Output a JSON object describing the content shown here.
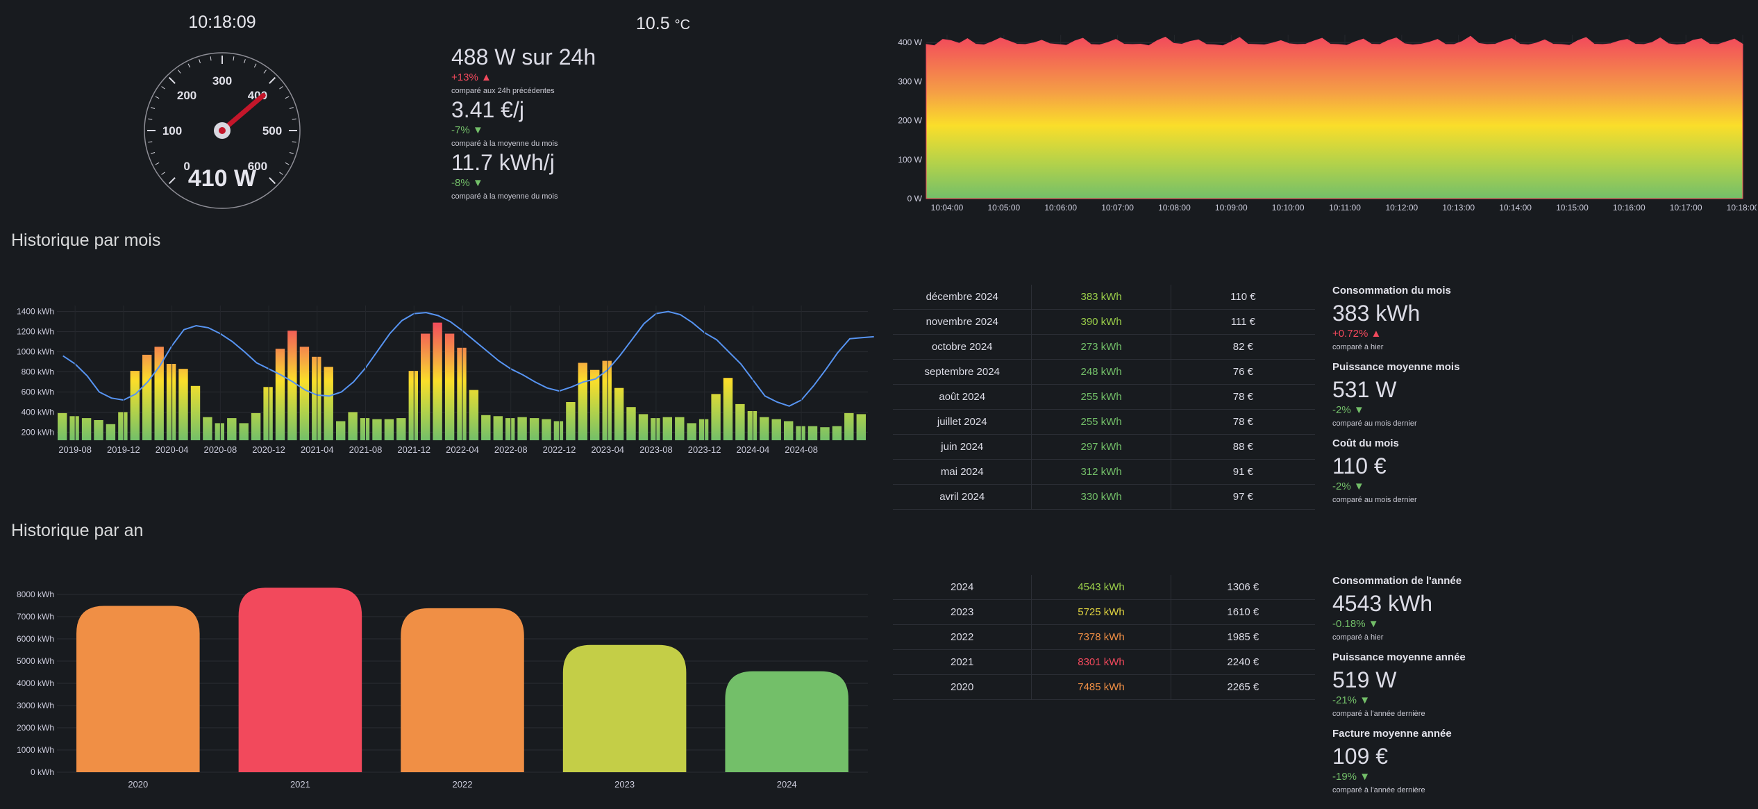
{
  "header": {
    "time": "10:18:09",
    "temperature": "10.5",
    "temperature_unit": "°C"
  },
  "gauge": {
    "value": 410,
    "display": "410 W",
    "min": 0,
    "max": 600,
    "labels": [
      "0",
      "100",
      "200",
      "300",
      "400",
      "500",
      "600"
    ]
  },
  "stats": [
    {
      "value": "488 W sur 24h",
      "delta": "+13%",
      "trend": "up",
      "caption": "comparé aux 24h précédentes"
    },
    {
      "value": "3.41 €/j",
      "delta": "-7%",
      "trend": "down",
      "caption": "comparé à la moyenne du mois"
    },
    {
      "value": "11.7 kWh/j",
      "delta": "-8%",
      "trend": "down",
      "caption": "comparé à la moyenne du mois"
    }
  ],
  "power_chart": {
    "type": "area",
    "y_ticks": [
      "0 W",
      "100 W",
      "200 W",
      "300 W",
      "400 W"
    ],
    "ylim": [
      0,
      420
    ],
    "x_ticks": [
      "10:04:00",
      "10:05:00",
      "10:06:00",
      "10:07:00",
      "10:08:00",
      "10:09:00",
      "10:10:00",
      "10:11:00",
      "10:12:00",
      "10:13:00",
      "10:14:00",
      "10:15:00",
      "10:16:00",
      "10:17:00",
      "10:18:00"
    ],
    "baseline": 400,
    "spike_samples": [
      395,
      392,
      408,
      405,
      398,
      410,
      396,
      394,
      402,
      412,
      404,
      396,
      395,
      399,
      406,
      397,
      395,
      393,
      404,
      411,
      395,
      394,
      400,
      408,
      396,
      395,
      396,
      392,
      405,
      414,
      398,
      396,
      403,
      407,
      395,
      394,
      392,
      402,
      413,
      396,
      395,
      394,
      399,
      405,
      397,
      395,
      396,
      404,
      411,
      396,
      395,
      393,
      402,
      409,
      396,
      395,
      405,
      412,
      397,
      394,
      396,
      401,
      408,
      395,
      395,
      403,
      416,
      398,
      395,
      396,
      404,
      410,
      396,
      394,
      399,
      407,
      396,
      395,
      393,
      405,
      413,
      396,
      395,
      397,
      404,
      408,
      396,
      395,
      400,
      412,
      397,
      394,
      396,
      406,
      410,
      396,
      395,
      402,
      409,
      396
    ]
  },
  "monthly_section": {
    "title": "Historique par mois"
  },
  "monthly_chart": {
    "type": "bar",
    "y_ticks": [
      "200 kWh",
      "400 kWh",
      "600 kWh",
      "800 kWh",
      "1000 kWh",
      "1200 kWh",
      "1400 kWh"
    ],
    "ylim": [
      120,
      1460
    ],
    "x_ticks": [
      "2019-08",
      "2019-12",
      "2020-04",
      "2020-08",
      "2020-12",
      "2021-04",
      "2021-08",
      "2021-12",
      "2022-04",
      "2022-08",
      "2022-12",
      "2023-04",
      "2023-08",
      "2023-12",
      "2024-04",
      "2024-08"
    ],
    "values": [
      390,
      360,
      340,
      320,
      280,
      400,
      810,
      970,
      1050,
      880,
      830,
      660,
      350,
      290,
      340,
      290,
      390,
      650,
      1030,
      1210,
      1050,
      950,
      850,
      310,
      400,
      340,
      330,
      330,
      340,
      810,
      1180,
      1290,
      1180,
      1040,
      620,
      370,
      360,
      340,
      350,
      340,
      330,
      310,
      500,
      890,
      820,
      910,
      640,
      450,
      380,
      340,
      350,
      350,
      290,
      330,
      580,
      740,
      480,
      410,
      350,
      330,
      310,
      260,
      260,
      250,
      260,
      390,
      380
    ],
    "trend_line": [
      960,
      880,
      760,
      600,
      540,
      520,
      580,
      700,
      860,
      1060,
      1220,
      1260,
      1240,
      1180,
      1100,
      1000,
      890,
      830,
      770,
      700,
      620,
      570,
      560,
      600,
      700,
      840,
      1010,
      1180,
      1310,
      1380,
      1390,
      1360,
      1300,
      1210,
      1110,
      1010,
      910,
      830,
      770,
      700,
      640,
      610,
      650,
      700,
      730,
      820,
      960,
      1120,
      1280,
      1380,
      1400,
      1370,
      1290,
      1190,
      1120,
      1000,
      880,
      720,
      560,
      500,
      460,
      520,
      660,
      820,
      990,
      1130,
      1140,
      1150
    ]
  },
  "monthly_table": [
    {
      "month": "décembre 2024",
      "kwh": "383 kWh",
      "cost": "110 €",
      "color": "#9ace4a"
    },
    {
      "month": "novembre 2024",
      "kwh": "390 kWh",
      "cost": "111 €",
      "color": "#9ace4a"
    },
    {
      "month": "octobre 2024",
      "kwh": "273 kWh",
      "cost": "82 €",
      "color": "#73bf69"
    },
    {
      "month": "septembre 2024",
      "kwh": "248 kWh",
      "cost": "76 €",
      "color": "#73bf69"
    },
    {
      "month": "août 2024",
      "kwh": "255 kWh",
      "cost": "78 €",
      "color": "#73bf69"
    },
    {
      "month": "juillet 2024",
      "kwh": "255 kWh",
      "cost": "78 €",
      "color": "#73bf69"
    },
    {
      "month": "juin 2024",
      "kwh": "297 kWh",
      "cost": "88 €",
      "color": "#73bf69"
    },
    {
      "month": "mai 2024",
      "kwh": "312 kWh",
      "cost": "91 €",
      "color": "#73bf69"
    },
    {
      "month": "avril 2024",
      "kwh": "330 kWh",
      "cost": "97 €",
      "color": "#73bf69"
    }
  ],
  "month_stats": [
    {
      "label": "Consommation du mois",
      "value": "383 kWh",
      "delta": "+0.72%",
      "trend": "up",
      "caption": "comparé à hier"
    },
    {
      "label": "Puissance moyenne mois",
      "value": "531 W",
      "delta": "-2%",
      "trend": "down",
      "caption": "comparé au mois dernier"
    },
    {
      "label": "Coût du mois",
      "value": "110 €",
      "delta": "-2%",
      "trend": "down",
      "caption": "comparé au mois dernier"
    }
  ],
  "yearly_section": {
    "title": "Historique par an"
  },
  "yearly_chart": {
    "type": "bar",
    "categories": [
      "2020",
      "2021",
      "2022",
      "2023",
      "2024"
    ],
    "values": [
      7485,
      8301,
      7378,
      5725,
      4543
    ],
    "colors": [
      "#f08f45",
      "#f2495c",
      "#f08f45",
      "#c4ce47",
      "#73bf69"
    ],
    "y_ticks": [
      "0 kWh",
      "1000 kWh",
      "2000 kWh",
      "3000 kWh",
      "4000 kWh",
      "5000 kWh",
      "6000 kWh",
      "7000 kWh",
      "8000 kWh"
    ],
    "ylim": [
      0,
      8000
    ]
  },
  "yearly_table": [
    {
      "year": "2024",
      "kwh": "4543 kWh",
      "cost": "1306 €",
      "color": "#9ace4a"
    },
    {
      "year": "2023",
      "kwh": "5725 kWh",
      "cost": "1610 €",
      "color": "#e0d340"
    },
    {
      "year": "2022",
      "kwh": "7378 kWh",
      "cost": "1985 €",
      "color": "#f08f45"
    },
    {
      "year": "2021",
      "kwh": "8301 kWh",
      "cost": "2240 €",
      "color": "#f2495c"
    },
    {
      "year": "2020",
      "kwh": "7485 kWh",
      "cost": "2265 €",
      "color": "#f08f45"
    }
  ],
  "year_stats": [
    {
      "label": "Consommation de l'année",
      "value": "4543 kWh",
      "delta": "-0.18%",
      "trend": "down",
      "caption": "comparé à hier"
    },
    {
      "label": "Puissance moyenne année",
      "value": "519 W",
      "delta": "-21%",
      "trend": "down",
      "caption": "comparé à l'année dernière"
    },
    {
      "label": "Facture moyenne année",
      "value": "109 €",
      "delta": "-19%",
      "trend": "down",
      "caption": "comparé à l'année dernière"
    }
  ]
}
